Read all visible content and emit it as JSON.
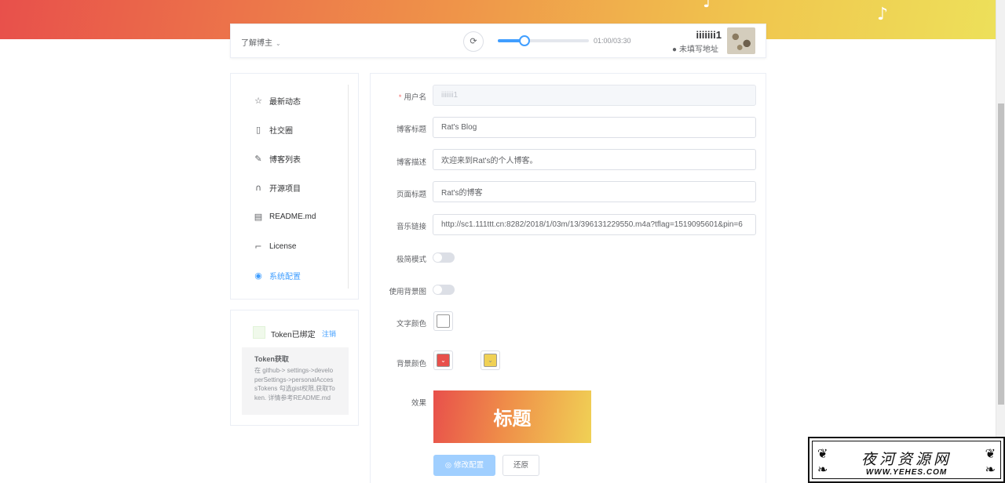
{
  "header": {
    "about_label": "了解博主",
    "time": "01:00/03:30",
    "progress": 0.29,
    "user_name": "iiiiiii1",
    "location": "未填写地址"
  },
  "menu": {
    "items": [
      {
        "label": "最新动态",
        "icon": "star-icon"
      },
      {
        "label": "社交圈",
        "icon": "mobile-icon"
      },
      {
        "label": "博客列表",
        "icon": "edit-icon"
      },
      {
        "label": "开源项目",
        "icon": "headset-icon"
      },
      {
        "label": "README.md",
        "icon": "document-icon"
      },
      {
        "label": "License",
        "icon": "tag-icon"
      },
      {
        "label": "系统配置",
        "icon": "config-icon",
        "active": true
      }
    ]
  },
  "token": {
    "status": "Token已绑定",
    "logout": "注销",
    "help_title": "Token获取",
    "help_text": "在 github-> settings->developerSettings->personalAccessTokens 勾选gist权限,获取Token. 详情参考README.md"
  },
  "form": {
    "username_label": "用户名",
    "username_value": "iiiiiii1",
    "blog_title_label": "博客标题",
    "blog_title_value": "Rat's Blog",
    "blog_desc_label": "博客描述",
    "blog_desc_value": "欢迎来到Rat's的个人博客。",
    "page_title_label": "页面标题",
    "page_title_value": "Rat's的博客",
    "music_label": "音乐链接",
    "music_value": "http://sc1.111ttt.cn:8282/2018/1/03m/13/396131229550.m4a?tflag=1519095601&pin=6",
    "minimal_label": "极简模式",
    "bg_image_label": "使用背景图",
    "text_color_label": "文字颜色",
    "bg_color_label": "背景颜色",
    "effect_label": "效果",
    "preview_text": "标题",
    "save_label": "修改配置",
    "reset_label": "还原"
  },
  "colors": {
    "text_color": "#ffffff",
    "bg_color_start": "#e8504b",
    "bg_color_end": "#f0d155",
    "accent": "#409eff"
  },
  "watermark": {
    "title": "夜河资源网",
    "url": "WWW.YEHES.COM"
  }
}
